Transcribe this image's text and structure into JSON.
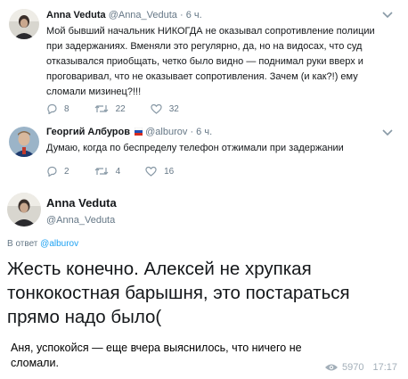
{
  "tweet1": {
    "name": "Anna Veduta",
    "handle": "@Anna_Veduta",
    "time": "· 6 ч.",
    "text_lines": [
      "Мой бывший начальник НИКОГДА не оказывал сопротивление полиции",
      "при задержаниях. Вменяли это регулярно, да, но на видосах, что суд",
      "отказывался приобщать, четко было видно — поднимал руки вверх и",
      "проговаривал, что не оказывает сопротивления. Зачем (и как?!) ему",
      "сломали мизинец?!!!"
    ],
    "replies": "8",
    "retweets": "22",
    "likes": "32"
  },
  "tweet2": {
    "name": "Георгий Албуров",
    "handle": "@alburov",
    "time": "· 6 ч.",
    "text": "Думаю, когда по беспределу телефон отжимали при задержании",
    "replies": "2",
    "retweets": "4",
    "likes": "16"
  },
  "main_tweet": {
    "name": "Anna Veduta",
    "handle": "@Anna_Veduta",
    "reply_prefix": "В ответ",
    "reply_user": "@alburov",
    "text_lines": [
      "Жесть конечно. Алексей не хрупкая",
      "тонкокостная барышня, это постараться",
      "прямо надо было("
    ]
  },
  "caption": {
    "text_lines": [
      "Аня, успокойся — еще вчера выяснилось, что ничего не",
      "сломали."
    ],
    "views": "5970",
    "time": "17:17"
  },
  "colors": {
    "secondary": "#657786",
    "link": "#1da1f2",
    "icon": "#8899a6",
    "meta": "#a3afb9"
  },
  "icons": [
    "chevron-down-icon",
    "reply-icon",
    "retweet-icon",
    "like-icon",
    "eye-icon"
  ]
}
